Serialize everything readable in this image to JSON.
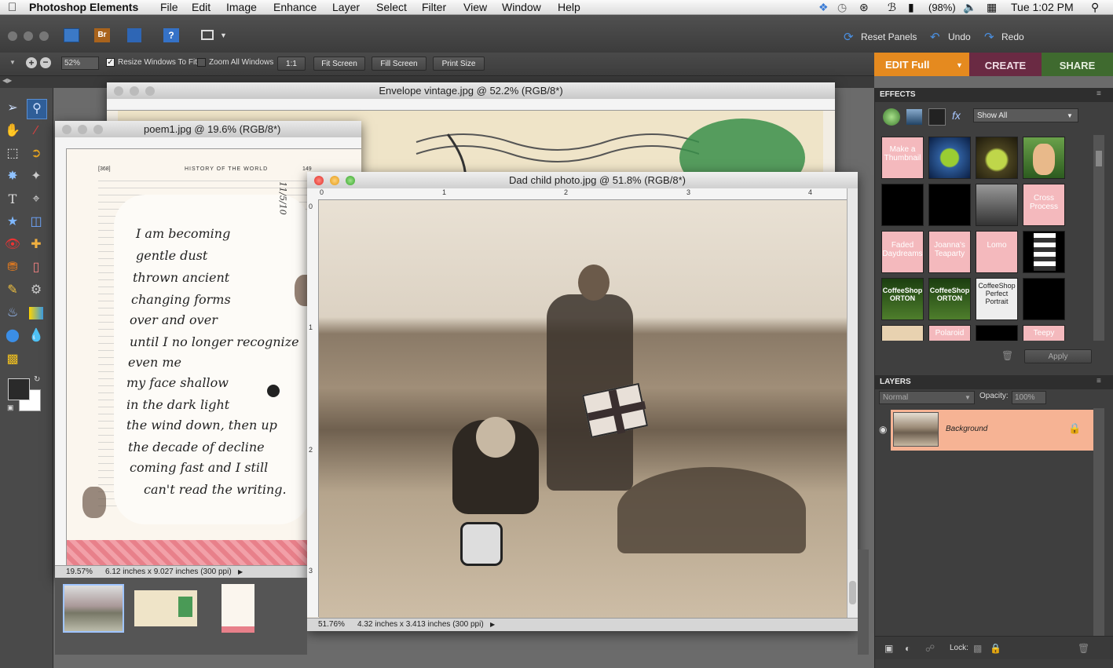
{
  "menubar": {
    "app_name": "Photoshop Elements",
    "items": [
      "File",
      "Edit",
      "Image",
      "Enhance",
      "Layer",
      "Select",
      "Filter",
      "View",
      "Window",
      "Help"
    ],
    "battery": "(98%)",
    "clock": "Tue 1:02 PM"
  },
  "toolbar": {
    "reset_panels": "Reset Panels",
    "undo": "Undo",
    "redo": "Redo",
    "bridge_label": "Br"
  },
  "options": {
    "zoom_value": "52%",
    "resize_windows": "Resize Windows To Fit",
    "zoom_all_windows": "Zoom All Windows",
    "one_to_one": "1:1",
    "fit_screen": "Fit Screen",
    "fill_screen": "Fill Screen",
    "print_size": "Print Size"
  },
  "modes": {
    "edit": "EDIT Full",
    "create": "CREATE",
    "share": "SHARE"
  },
  "documents": {
    "envelope": {
      "title": "Envelope vintage.jpg @ 52.2% (RGB/8*)"
    },
    "poem": {
      "title": "poem1.jpg @ 19.6% (RGB/8*)",
      "zoom": "19.57%",
      "info": "6.12 inches x 9.027 inches (300 ppi)",
      "page_header": "HISTORY OF THE WORLD",
      "page_number": "149",
      "page_left_number": "[368]",
      "date_note": "11/5/10",
      "handwriting": [
        "I am becoming",
        "gentle dust",
        "thrown      ancient",
        "changing forms",
        "over and over",
        "until I no longer recognize",
        "even me",
        "my face shallow",
        "in the dark light",
        "the wind down, then up",
        "the decade of decline",
        "coming fast  and I still",
        "can't read the writing."
      ]
    },
    "dad": {
      "title": "Dad child photo.jpg @ 51.8% (RGB/8*)",
      "zoom": "51.76%",
      "info": "4.32 inches x 3.413 inches (300 ppi)",
      "ruler_h": [
        "0",
        "1",
        "2",
        "3",
        "4"
      ],
      "ruler_v": [
        "0",
        "1",
        "2",
        "3"
      ]
    }
  },
  "effects": {
    "header": "EFFECTS",
    "filter_value": "Show All",
    "thumbs": [
      {
        "label": "Make a Thumbnail",
        "kind": "pink"
      },
      {
        "label": "",
        "kind": "image-blue"
      },
      {
        "label": "",
        "kind": "image-apple"
      },
      {
        "label": "",
        "kind": "image-child"
      },
      {
        "label": "",
        "kind": "black"
      },
      {
        "label": "",
        "kind": "black"
      },
      {
        "label": "",
        "kind": "image-bw"
      },
      {
        "label": "Cross Process",
        "kind": "pink"
      },
      {
        "label": "Faded Daydreams",
        "kind": "pink"
      },
      {
        "label": "Joanna's Teaparty",
        "kind": "pink"
      },
      {
        "label": "Lomo",
        "kind": "pink"
      },
      {
        "label": "",
        "kind": "image-strip"
      },
      {
        "label": "CoffeeShop ORTON",
        "kind": "orton"
      },
      {
        "label": "CoffeeShop ORTON",
        "kind": "orton"
      },
      {
        "label": "CoffeeShop Perfect Portrait",
        "kind": "portrait"
      },
      {
        "label": "",
        "kind": "black"
      },
      {
        "label": "",
        "kind": "image-partial"
      },
      {
        "label": "Polaroid",
        "kind": "pink"
      },
      {
        "label": "",
        "kind": "black"
      },
      {
        "label": "Teepy",
        "kind": "pink"
      }
    ],
    "apply": "Apply"
  },
  "layers": {
    "header": "LAYERS",
    "blend_mode": "Normal",
    "opacity_label": "Opacity:",
    "opacity_value": "100%",
    "layer_name": "Background",
    "lock_label": "Lock:"
  },
  "colors": {
    "edit_mode": "#e58a1f",
    "create_mode": "#6a2a43",
    "share_mode": "#3f6a2f",
    "layer_highlight": "#f6b394"
  }
}
